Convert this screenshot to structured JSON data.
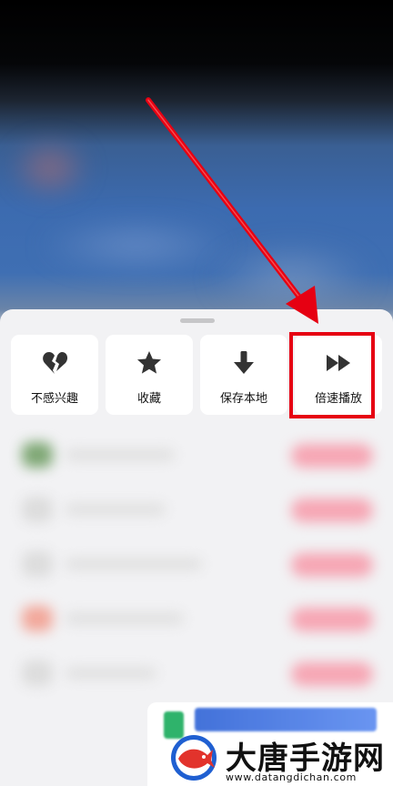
{
  "sheet": {
    "actions": [
      {
        "label": "不感兴趣",
        "icon": "broken-heart-icon"
      },
      {
        "label": "收藏",
        "icon": "star-icon"
      },
      {
        "label": "保存本地",
        "icon": "download-arrow-icon"
      },
      {
        "label": "倍速播放",
        "icon": "fast-forward-icon"
      }
    ],
    "highlighted_action": "倍速播放"
  },
  "annotation": {
    "color": "#e60012"
  },
  "watermark": {
    "title": "大唐手游网",
    "url": "www.datangdichan.com"
  }
}
